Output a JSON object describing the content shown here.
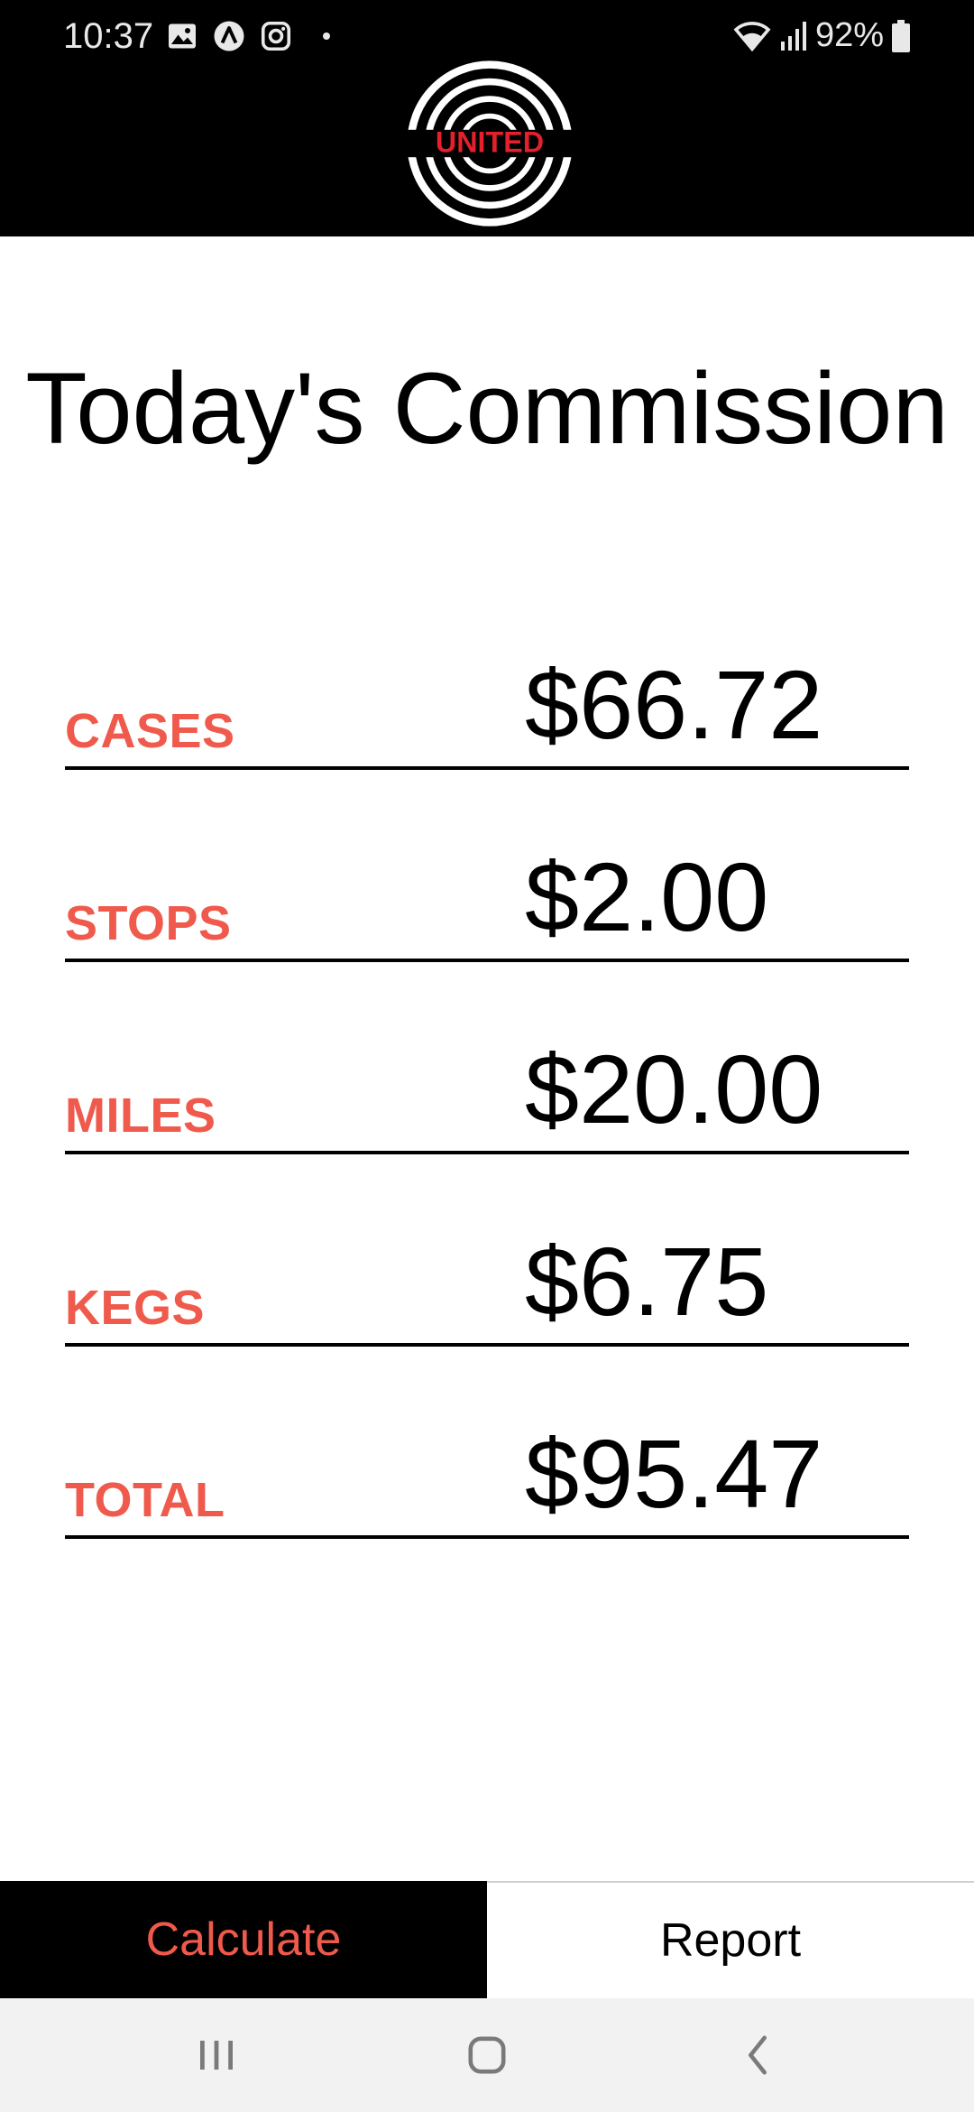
{
  "status_bar": {
    "time": "10:37",
    "battery": "92%",
    "icons_left": [
      "gallery-icon",
      "a-circle-icon",
      "instagram-icon"
    ],
    "icons_right": [
      "wifi-icon",
      "signal-icon",
      "battery-icon"
    ]
  },
  "header": {
    "logo_text": "UNITED",
    "logo_color": "#e3202b"
  },
  "main": {
    "title": "Today's Commission",
    "rows": [
      {
        "label": "CASES",
        "value": "$66.72"
      },
      {
        "label": "STOPS",
        "value": "$2.00"
      },
      {
        "label": "MILES",
        "value": "$20.00"
      },
      {
        "label": "KEGS",
        "value": "$6.75"
      },
      {
        "label": "TOTAL",
        "value": "$95.47"
      }
    ]
  },
  "tabs": {
    "calculate": "Calculate",
    "report": "Report"
  },
  "colors": {
    "accent": "#ef5a4c",
    "header_bg": "#000000",
    "navbar_bg": "#f2f2f2"
  }
}
